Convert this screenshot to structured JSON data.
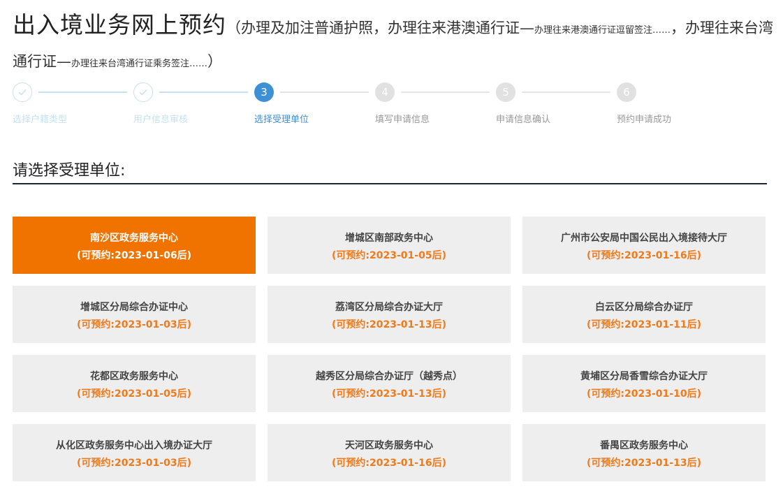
{
  "header": {
    "title_main": "出入境业务网上预约",
    "subtitle_open": "（办理及加注普通护照，办理往来港澳通行证—",
    "subtitle_note1": "办理往来港澳通行证逗留签注……",
    "subtitle_mid": "，办理往来台湾通行证—",
    "subtitle_note2": "办理往来台湾通行证乘务签注……",
    "subtitle_close": "）"
  },
  "steps": [
    {
      "number": "1",
      "label": "选择户籍类型",
      "status": "done",
      "icon": "check-icon"
    },
    {
      "number": "2",
      "label": "用户信息审核",
      "status": "done",
      "icon": "check-icon"
    },
    {
      "number": "3",
      "label": "选择受理单位",
      "status": "active"
    },
    {
      "number": "4",
      "label": "填写申请信息",
      "status": "todo"
    },
    {
      "number": "5",
      "label": "申请信息确认",
      "status": "todo"
    },
    {
      "number": "6",
      "label": "预约申请成功",
      "status": "todo"
    }
  ],
  "section_title": "请选择受理单位:",
  "units": [
    {
      "name": "南沙区政务服务中心",
      "date": "(可预约:2023-01-06后)",
      "selected": true
    },
    {
      "name": "增城区南部政务中心",
      "date": "(可预约:2023-01-05后)"
    },
    {
      "name": "广州市公安局中国公民出入境接待大厅",
      "date": "(可预约:2023-01-16后)"
    },
    {
      "name": "增城区分局综合办证中心",
      "date": "(可预约:2023-01-03后)"
    },
    {
      "name": "荔湾区分局综合办证大厅",
      "date": "(可预约:2023-01-13后)"
    },
    {
      "name": "白云区分局综合办证厅",
      "date": "(可预约:2023-01-11后)"
    },
    {
      "name": "花都区政务服务中心",
      "date": "(可预约:2023-01-05后)"
    },
    {
      "name": "越秀区分局综合办证厅（越秀点）",
      "date": "(可预约:2023-01-13后)"
    },
    {
      "name": "黄埔区分局香雪综合办证大厅",
      "date": "(可预约:2023-01-10后)"
    },
    {
      "name": "从化区政务服务中心出入境办证大厅",
      "date": "(可预约:2023-01-03后)"
    },
    {
      "name": "天河区政务服务中心",
      "date": "(可预约:2023-01-16后)"
    },
    {
      "name": "番禺区政务服务中心",
      "date": "(可预约:2023-01-13后)"
    }
  ],
  "colors": {
    "selected_bg": "#f07300",
    "date_text": "#f07a1a",
    "active_step": "#3d8fd6",
    "done_step": "#c5e1f2",
    "card_bg": "#eeeeee"
  }
}
